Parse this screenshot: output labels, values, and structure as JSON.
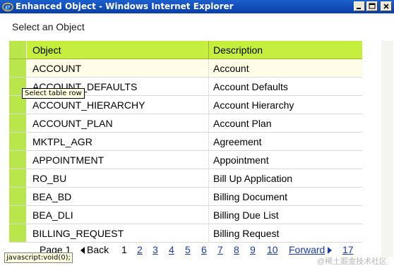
{
  "window": {
    "title": "Enhanced Object - Windows Internet Explorer"
  },
  "dialog": {
    "heading": "Select an Object"
  },
  "table": {
    "columns": [
      "Object",
      "Description"
    ],
    "rows": [
      {
        "object": "ACCOUNT",
        "description": "Account"
      },
      {
        "object": "ACCOUNT_DEFAULTS",
        "description": "Account Defaults"
      },
      {
        "object": "ACCOUNT_HIERARCHY",
        "description": "Account Hierarchy"
      },
      {
        "object": "ACCOUNT_PLAN",
        "description": "Account Plan"
      },
      {
        "object": "MKTPL_AGR",
        "description": "Agreement"
      },
      {
        "object": "APPOINTMENT",
        "description": "Appointment"
      },
      {
        "object": "RO_BU",
        "description": "Bill Up Application"
      },
      {
        "object": "BEA_BD",
        "description": "Billing Document"
      },
      {
        "object": "BEA_DLI",
        "description": "Billing Due List"
      },
      {
        "object": "BILLING_REQUEST",
        "description": "Billing Request"
      }
    ],
    "tooltip": "Select table row"
  },
  "pager": {
    "page_label": "Page 1",
    "back": "Back",
    "current": "1",
    "pages": [
      "2",
      "3",
      "4",
      "5",
      "6",
      "7",
      "8",
      "9",
      "10"
    ],
    "forward": "Forward",
    "last": "17"
  },
  "status": {
    "text": "javascript:void(0);"
  },
  "watermark": "@稀土掘金技术社区",
  "colors": {
    "titlebar": "#0a3fa8",
    "header": "#c6ee3f",
    "selector": "#b9e64a",
    "link": "#1a3ca8"
  }
}
